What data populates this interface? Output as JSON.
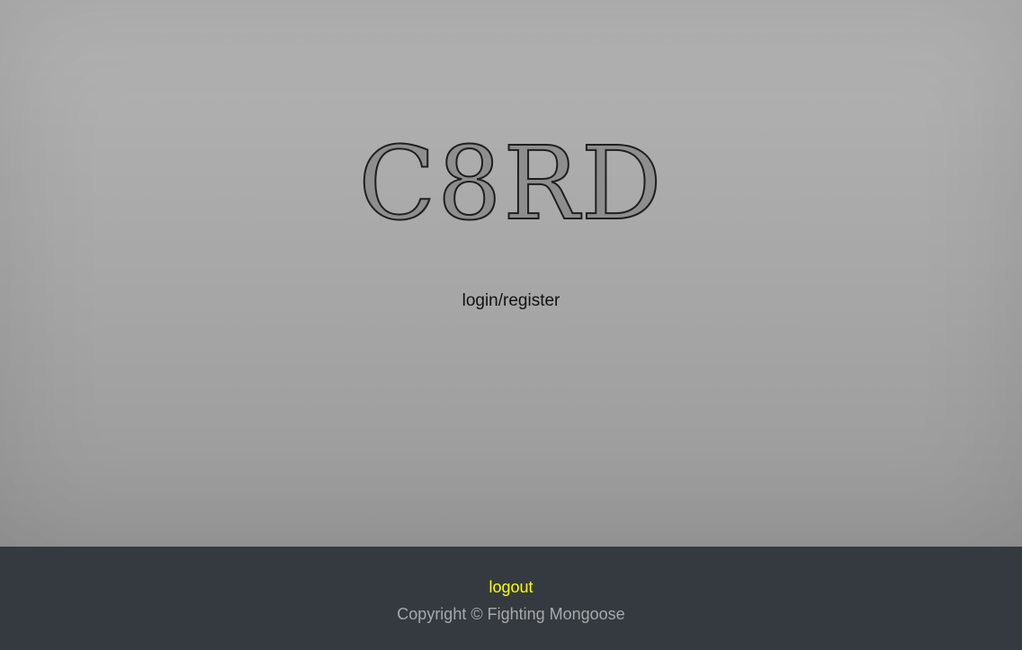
{
  "logo": {
    "text": "C8RD"
  },
  "main": {
    "auth_link": "login/register"
  },
  "footer": {
    "logout_label": "logout",
    "copyright": "Copyright © Fighting Mongoose"
  },
  "colors": {
    "footer_bg": "#343a40",
    "logout": "#ffff00",
    "copyright": "#a7a9ab"
  }
}
